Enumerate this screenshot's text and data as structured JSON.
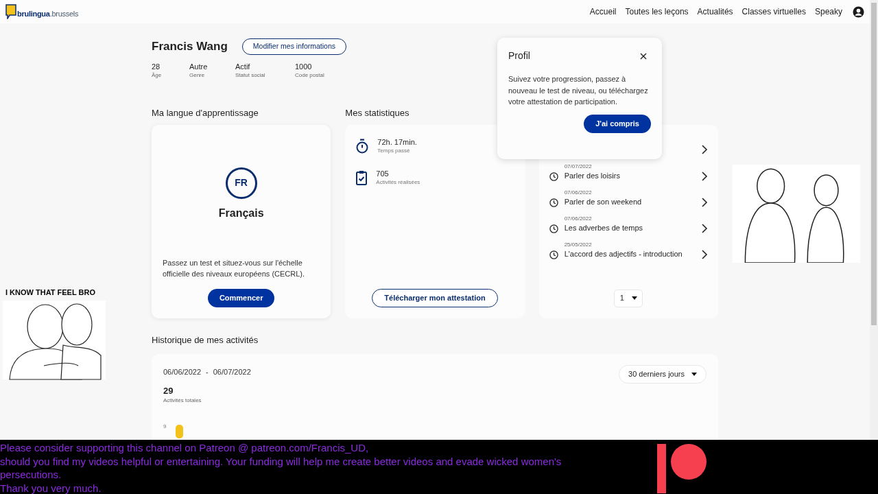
{
  "header": {
    "logo_main": "brulingua",
    "logo_suffix": ".brussels",
    "nav": [
      {
        "label": "Accueil"
      },
      {
        "label": "Toutes les leçons"
      },
      {
        "label": "Actualités"
      },
      {
        "label": "Classes virtuelles"
      },
      {
        "label": "Speaky"
      }
    ]
  },
  "profile": {
    "name": "Francis Wang",
    "edit_button": "Modifier mes informations",
    "facts": [
      {
        "value": "28",
        "label": "Âge"
      },
      {
        "value": "Autre",
        "label": "Genre"
      },
      {
        "value": "Actif",
        "label": "Statut social"
      },
      {
        "value": "1000",
        "label": "Code postal"
      }
    ]
  },
  "language": {
    "title": "Ma langue d'apprentissage",
    "code": "FR",
    "name": "Français",
    "text": "Passez un test et situez-vous sur l'échelle officielle des niveaux européens (CECRL).",
    "button": "Commencer"
  },
  "stats": {
    "title": "Mes statistiques",
    "items": [
      {
        "kind": "time",
        "value": "72h. 17min.",
        "label": "Temps passé"
      },
      {
        "kind": "activities",
        "value": "705",
        "label": "Activités réalisées"
      }
    ],
    "button": "Télécharger mon attestation"
  },
  "lessons": {
    "items": [
      {
        "date": "07/07/2022",
        "title": "Parler des loisirs"
      },
      {
        "date": "07/06/2022",
        "title": "Parler de son weekend"
      },
      {
        "date": "07/06/2022",
        "title": "Les adverbes de temps"
      },
      {
        "date": "25/05/2022",
        "title": "L'accord des adjectifs - introduction"
      }
    ],
    "page": "1"
  },
  "history": {
    "title": "Historique de mes activités",
    "date_from": "06/06/2022",
    "date_sep": "-",
    "date_to": "06/07/2022",
    "period": "30 derniers jours",
    "total": "29",
    "total_label": "Activités totales",
    "tick_label": "9"
  },
  "popover": {
    "title": "Profil",
    "text": "Suivez votre progression, passez à nouveau le test de niveau, ou téléchargez votre attestation de participation.",
    "button": "J'ai compris"
  },
  "overlay": {
    "caption": "I KNOW THAT FEEL BRO",
    "banner_lines": [
      "Please consider supporting this channel on Patreon @ patreon.com/Francis_UD,",
      "should you find my videos helpful or entertaining. Your funding will help me create better videos and evade wicked women's",
      "persecutions.",
      "Thank you very much."
    ]
  }
}
